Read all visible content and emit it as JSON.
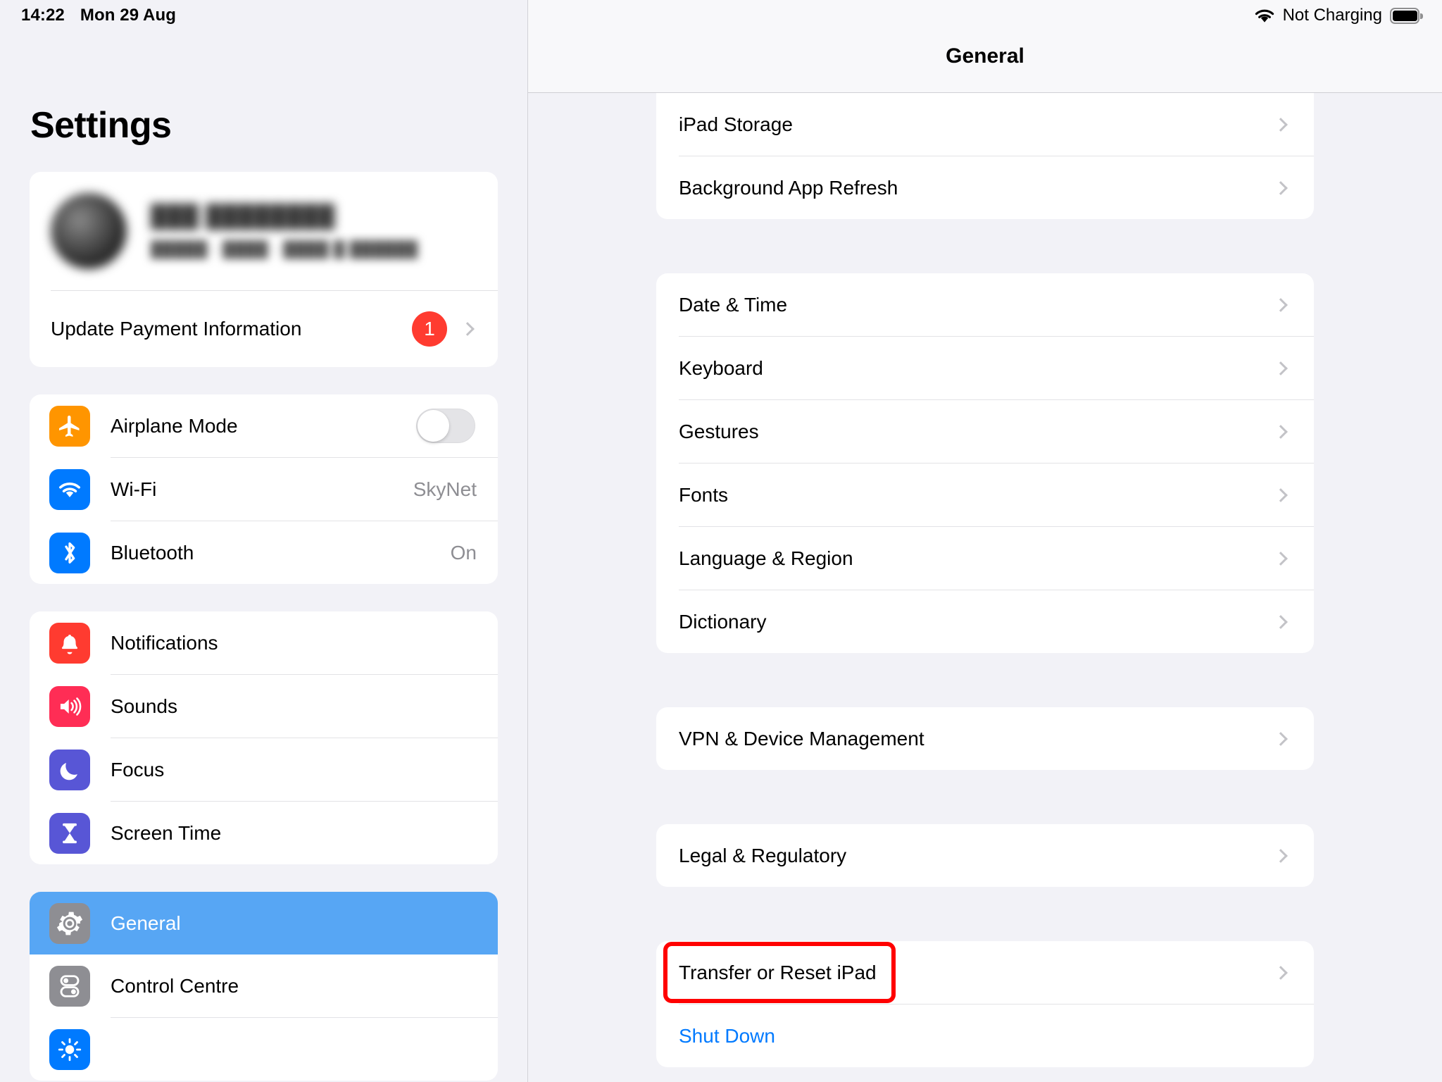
{
  "status_bar": {
    "time": "14:22",
    "date": "Mon 29 Aug",
    "wifi_icon": "wifi-icon",
    "charging_status": "Not Charging",
    "battery_icon": "battery-full-icon"
  },
  "sidebar": {
    "title": "Settings",
    "apple_id": {
      "name_redacted": "███ ████████",
      "subtitle_redacted": "█████ · ████ · ████ █ ██████",
      "update_payment_label": "Update Payment Information",
      "badge_count": "1",
      "avatar_icon": "avatar-image"
    },
    "groups": [
      {
        "items": [
          {
            "label": "Airplane Mode",
            "icon": "airplane-icon",
            "icon_class": "ic-plane",
            "glyph": "✈",
            "control": "toggle",
            "toggle_on": false,
            "value": ""
          },
          {
            "label": "Wi-Fi",
            "icon": "wifi-icon",
            "icon_class": "ic-wifi",
            "glyph": "",
            "control": "value",
            "value": "SkyNet"
          },
          {
            "label": "Bluetooth",
            "icon": "bluetooth-icon",
            "icon_class": "ic-bt",
            "glyph": "",
            "control": "value",
            "value": "On"
          }
        ]
      },
      {
        "items": [
          {
            "label": "Notifications",
            "icon": "bell-icon",
            "icon_class": "ic-notif",
            "glyph": "🔔",
            "control": "none",
            "value": ""
          },
          {
            "label": "Sounds",
            "icon": "speaker-icon",
            "icon_class": "ic-sound",
            "glyph": "🔊",
            "control": "none",
            "value": ""
          },
          {
            "label": "Focus",
            "icon": "moon-icon",
            "icon_class": "ic-focus",
            "glyph": "🌙",
            "control": "none",
            "value": ""
          },
          {
            "label": "Screen Time",
            "icon": "hourglass-icon",
            "icon_class": "ic-screen",
            "glyph": "⌛",
            "control": "none",
            "value": ""
          }
        ]
      },
      {
        "items": [
          {
            "label": "General",
            "icon": "gear-icon",
            "icon_class": "ic-gen",
            "glyph": "⚙",
            "control": "none",
            "value": "",
            "selected": true
          },
          {
            "label": "Control Centre",
            "icon": "control-centre-icon",
            "icon_class": "ic-cc",
            "glyph": "",
            "control": "none",
            "value": ""
          },
          {
            "label": "",
            "icon": "display-brightness-icon",
            "icon_class": "ic-disp",
            "glyph": "",
            "control": "none",
            "value": ""
          }
        ]
      }
    ]
  },
  "detail": {
    "title": "General",
    "groups": [
      {
        "cut_top": true,
        "items": [
          {
            "label": "iPad Storage",
            "chevron": true,
            "link": false
          },
          {
            "label": "Background App Refresh",
            "chevron": true,
            "link": false
          }
        ]
      },
      {
        "cut_top": false,
        "items": [
          {
            "label": "Date & Time",
            "chevron": true,
            "link": false
          },
          {
            "label": "Keyboard",
            "chevron": true,
            "link": false
          },
          {
            "label": "Gestures",
            "chevron": true,
            "link": false
          },
          {
            "label": "Fonts",
            "chevron": true,
            "link": false
          },
          {
            "label": "Language & Region",
            "chevron": true,
            "link": false
          },
          {
            "label": "Dictionary",
            "chevron": true,
            "link": false
          }
        ]
      },
      {
        "cut_top": false,
        "items": [
          {
            "label": "VPN & Device Management",
            "chevron": true,
            "link": false
          }
        ]
      },
      {
        "cut_top": false,
        "items": [
          {
            "label": "Legal & Regulatory",
            "chevron": true,
            "link": false
          }
        ]
      },
      {
        "cut_top": false,
        "items": [
          {
            "label": "Transfer or Reset iPad",
            "chevron": true,
            "link": false,
            "annotated": true
          },
          {
            "label": "Shut Down",
            "chevron": false,
            "link": true
          }
        ]
      }
    ]
  },
  "annotation": {
    "target_label": "Transfer or Reset iPad",
    "color": "#ff0000"
  }
}
